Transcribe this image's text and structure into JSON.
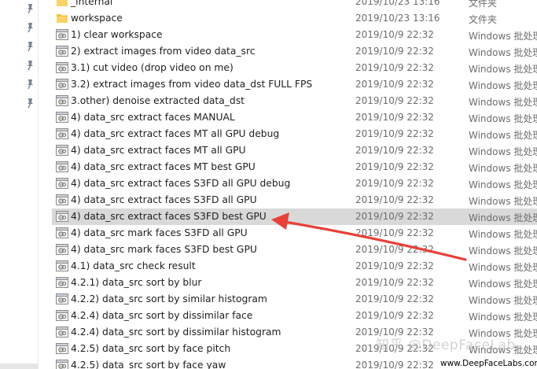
{
  "colors": {
    "selected_row": "#d9d9d9",
    "folder": "#f5c443",
    "arrow": "#e8403a",
    "date_text": "#6d6d6d"
  },
  "files": [
    {
      "name": "_internal",
      "date": "2019/10/23 13:16",
      "type": "文件夹",
      "icon": "folder-icon"
    },
    {
      "name": "workspace",
      "date": "2019/10/23 13:16",
      "type": "文件夹",
      "icon": "folder-icon"
    },
    {
      "name": "1) clear workspace",
      "date": "2019/10/9 22:32",
      "type": "Windows 批处理",
      "icon": "batch-file-icon"
    },
    {
      "name": "2) extract images from video data_src",
      "date": "2019/10/9 22:32",
      "type": "Windows 批处理",
      "icon": "batch-file-icon"
    },
    {
      "name": "3.1) cut video (drop video on me)",
      "date": "2019/10/9 22:32",
      "type": "Windows 批处理",
      "icon": "batch-file-icon"
    },
    {
      "name": "3.2) extract images from video data_dst FULL FPS",
      "date": "2019/10/9 22:32",
      "type": "Windows 批处理",
      "icon": "batch-file-icon"
    },
    {
      "name": "3.other) denoise extracted data_dst",
      "date": "2019/10/9 22:32",
      "type": "Windows 批处理",
      "icon": "batch-file-icon"
    },
    {
      "name": "4) data_src extract faces MANUAL",
      "date": "2019/10/9 22:32",
      "type": "Windows 批处理",
      "icon": "batch-file-icon"
    },
    {
      "name": "4) data_src extract faces MT all GPU debug",
      "date": "2019/10/9 22:32",
      "type": "Windows 批处理",
      "icon": "batch-file-icon"
    },
    {
      "name": "4) data_src extract faces MT all GPU",
      "date": "2019/10/9 22:32",
      "type": "Windows 批处理",
      "icon": "batch-file-icon"
    },
    {
      "name": "4) data_src extract faces MT best GPU",
      "date": "2019/10/9 22:32",
      "type": "Windows 批处理",
      "icon": "batch-file-icon"
    },
    {
      "name": "4) data_src extract faces S3FD all GPU debug",
      "date": "2019/10/9 22:32",
      "type": "Windows 批处理",
      "icon": "batch-file-icon"
    },
    {
      "name": "4) data_src extract faces S3FD all GPU",
      "date": "2019/10/9 22:32",
      "type": "Windows 批处理",
      "icon": "batch-file-icon"
    },
    {
      "name": "4) data_src extract faces S3FD best GPU",
      "date": "2019/10/9 22:32",
      "type": "Windows 批处理",
      "icon": "batch-file-icon",
      "selected": true
    },
    {
      "name": "4) data_src mark faces S3FD all GPU",
      "date": "2019/10/9 22:32",
      "type": "Windows 批处理",
      "icon": "batch-file-icon"
    },
    {
      "name": "4) data_src mark faces S3FD best GPU",
      "date": "2019/10/9 22:32",
      "type": "Windows 批处理",
      "icon": "batch-file-icon"
    },
    {
      "name": "4.1) data_src check result",
      "date": "2019/10/9 22:32",
      "type": "Windows 批处理",
      "icon": "batch-file-icon"
    },
    {
      "name": "4.2.1) data_src sort by blur",
      "date": "2019/10/9 22:32",
      "type": "Windows 批处理",
      "icon": "batch-file-icon"
    },
    {
      "name": "4.2.2) data_src sort by similar histogram",
      "date": "2019/10/9 22:32",
      "type": "Windows 批处理",
      "icon": "batch-file-icon"
    },
    {
      "name": "4.2.4) data_src sort by dissimilar face",
      "date": "2019/10/9 22:32",
      "type": "Windows 批处理",
      "icon": "batch-file-icon"
    },
    {
      "name": "4.2.4) data_src sort by dissimilar histogram",
      "date": "2019/10/9 22:32",
      "type": "Windows 批处理",
      "icon": "batch-file-icon"
    },
    {
      "name": "4.2.5) data_src sort by face pitch",
      "date": "2019/10/9 22:32",
      "type": "Windows 批处理",
      "icon": "batch-file-icon"
    },
    {
      "name": "4.2.5) data_src sort by face yaw",
      "date": "2019/10/9 22:32",
      "type": "Windows 批处理",
      "icon": "batch-file-icon"
    }
  ],
  "pins": [
    "pin-icon",
    "pin-icon",
    "pin-icon",
    "pin-icon",
    "pin-icon",
    "pin-icon"
  ],
  "watermark": {
    "text": "知乎 @DeepFaceLab",
    "url": "www.DeepFaceLabs.com"
  }
}
